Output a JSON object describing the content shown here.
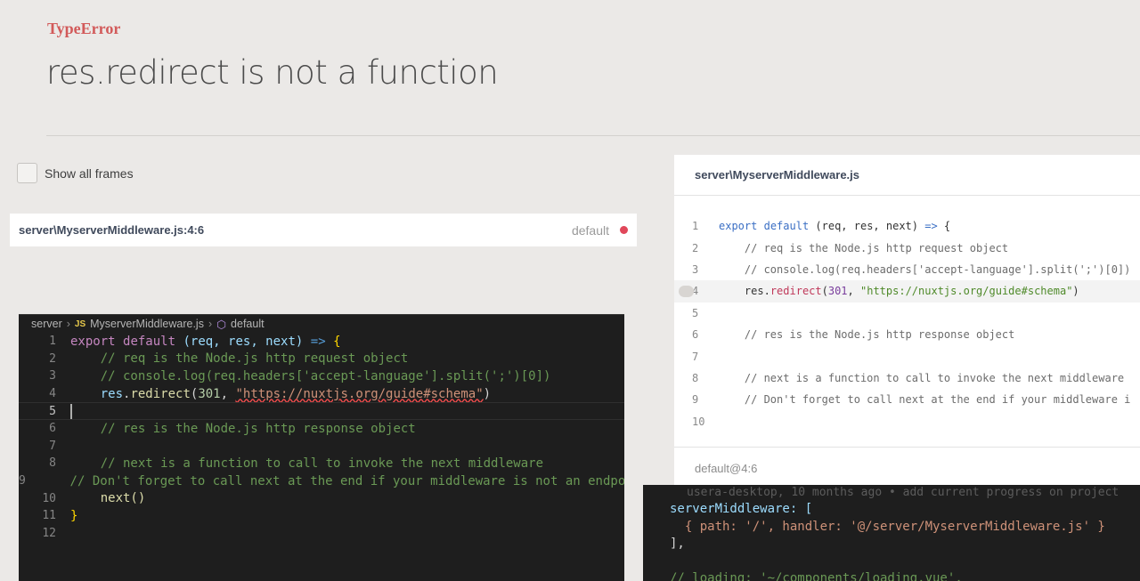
{
  "error": {
    "type": "TypeError",
    "message": "res.redirect is not a function"
  },
  "show_all_frames": {
    "label": "Show all frames",
    "checked": false
  },
  "frame": {
    "file": "server\\MyserverMiddleware.js:4:6",
    "fn": "default"
  },
  "source_panel": {
    "file": "server\\MyserverMiddleware.js",
    "footer": "default@4:6",
    "highlighted_line": 4,
    "lines": [
      {
        "n": "1"
      },
      {
        "n": "2"
      },
      {
        "n": "3"
      },
      {
        "n": "4"
      },
      {
        "n": "5"
      },
      {
        "n": "6"
      },
      {
        "n": "7"
      },
      {
        "n": "8"
      },
      {
        "n": "9"
      },
      {
        "n": "10"
      }
    ]
  },
  "editor": {
    "breadcrumb": {
      "folder": "server",
      "js_badge": "JS",
      "file": "MyserverMiddleware.js",
      "symbol": "default"
    },
    "current_line": 5,
    "line_numbers": [
      "1",
      "2",
      "3",
      "4",
      "5",
      "6",
      "7",
      "8",
      "9",
      "10",
      "11",
      "12"
    ]
  },
  "editor2": {
    "blame": "usera-desktop, 10 months ago • add current progress on project",
    "lines": [
      "serverMiddleware: [",
      "  { path: '/', handler: '@/server/MyserverMiddleware.js' }",
      "],",
      "",
      "// loading: '~/components/loading.vue',"
    ]
  },
  "code": {
    "l1_export": "export",
    "l1_default": "default",
    "l1_params": "(req, res, next)",
    "l1_arrow": "=>",
    "l1_brace": "{",
    "l2": "// req is the Node.js http request object",
    "l3": "// console.log(req.headers['accept-language'].split(';')[0])",
    "l4_obj": "res",
    "l4_fn": "redirect",
    "l4_num": "301",
    "l4_str": "\"https://nuxtjs.org/guide#schema\"",
    "l6": "// res is the Node.js http response object",
    "l8": "// next is a function to call to invoke the next middleware",
    "l9_full": "// Don't forget to call next at the end if your middleware is not an endpoint!",
    "l9_panel": "// Don't forget to call next at the end if your middleware i",
    "l10": "next()",
    "l11": "}"
  },
  "colors": {
    "error_type": "#d25a5a",
    "frame_dot": "#e0475a",
    "background": "#ebe9e7"
  }
}
